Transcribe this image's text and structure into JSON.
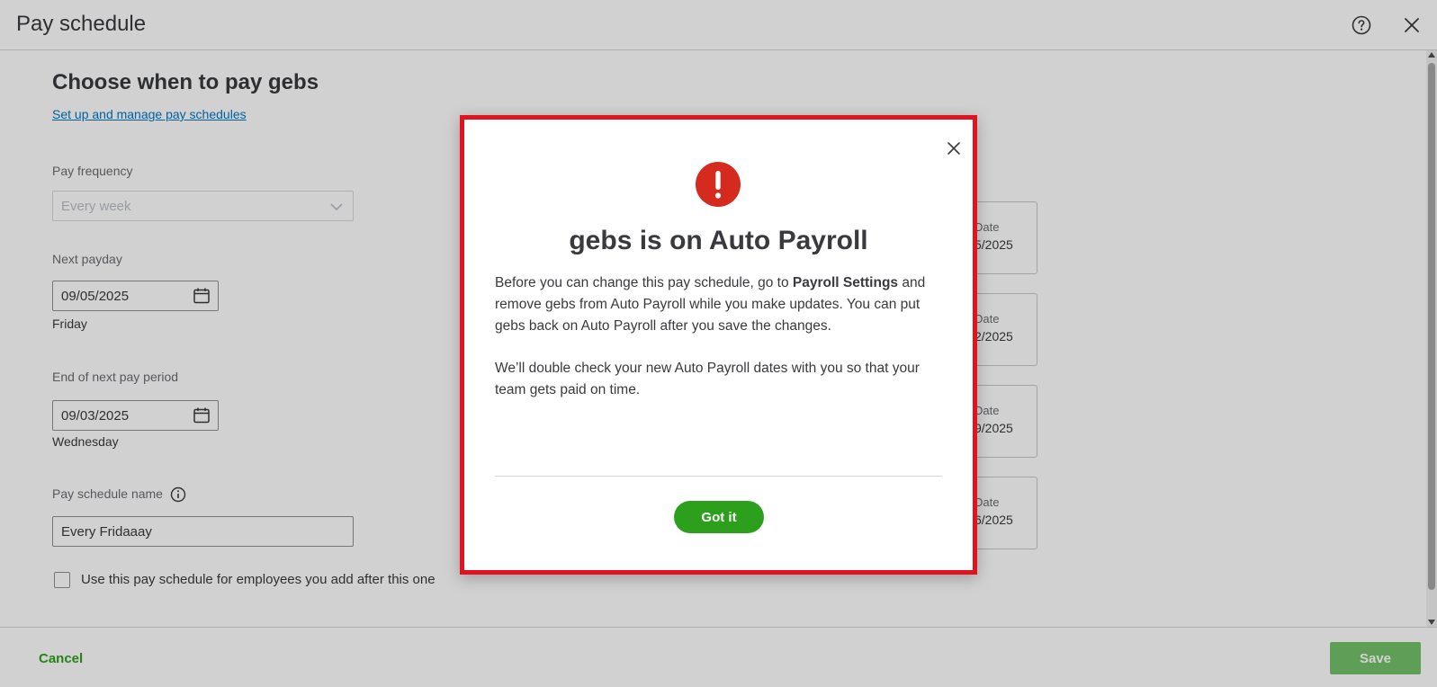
{
  "header": {
    "title": "Pay schedule"
  },
  "page": {
    "heading": "Choose when to pay gebs",
    "manage_link": "Set up and manage pay schedules"
  },
  "form": {
    "pay_frequency": {
      "label": "Pay frequency",
      "value": "Every week"
    },
    "next_payday": {
      "label": "Next payday",
      "value": "09/05/2025",
      "weekday": "Friday"
    },
    "end_of_period": {
      "label": "End of next pay period",
      "value": "09/03/2025",
      "weekday": "Wednesday"
    },
    "schedule_name": {
      "label": "Pay schedule name",
      "value": "Every Fridaaay"
    },
    "checkbox_label": "Use this pay schedule for employees you add after this one"
  },
  "date_cards": [
    {
      "label": "Date",
      "value": "5/2025"
    },
    {
      "label": "Date",
      "value": "2/2025"
    },
    {
      "label": "Date",
      "value": "9/2025"
    },
    {
      "label": "Date",
      "value": "6/2025"
    }
  ],
  "footer": {
    "cancel_label": "Cancel",
    "save_label": "Save"
  },
  "modal": {
    "title": "gebs is on Auto Payroll",
    "para1_before": "Before you can change this pay schedule, go to ",
    "para1_bold": "Payroll Settings",
    "para1_after": " and remove gebs from Auto Payroll while you make updates. You can put gebs back on Auto Payroll after you save the changes.",
    "para2": "We’ll double check your new Auto Payroll dates with you so that your team gets paid on time.",
    "button_label": "Got it"
  },
  "colors": {
    "brand_green": "#2ca01c",
    "alert_red": "#d52b1e",
    "highlight_border": "#e0131f",
    "link_blue": "#0077c5"
  },
  "icons": [
    "help-icon",
    "close-icon",
    "calendar-icon",
    "chevron-down-icon",
    "info-icon",
    "alert-icon"
  ]
}
